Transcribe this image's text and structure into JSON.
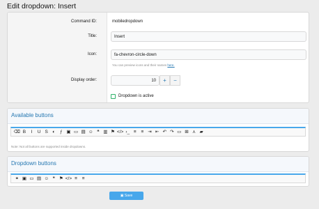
{
  "page": {
    "title": "Edit dropdown: Insert"
  },
  "form": {
    "command_id": {
      "label": "Command ID:",
      "value": "mobiledropdown"
    },
    "title": {
      "label": "Title:",
      "value": "Insert"
    },
    "icon": {
      "label": "Icon:",
      "value": "fa-chevron-circle-down",
      "hint_prefix": "You can preview icons and their names ",
      "hint_link": "here."
    },
    "display_order": {
      "label": "Display order:",
      "value": "10",
      "plus": "+",
      "minus": "−"
    },
    "active": {
      "label": "Dropdown is active",
      "checked": false
    }
  },
  "available": {
    "title": "Available buttons",
    "note": "Note: Not all buttons are supported inside dropdowns.",
    "icons": [
      "eraser-icon",
      "bold-icon",
      "italic-icon",
      "underline-icon",
      "strikethrough-icon",
      "color-drop-icon",
      "font-icon",
      "image-icon",
      "video-icon",
      "media-icon",
      "smiley-icon",
      "quote-icon",
      "spoiler-icon",
      "flag-icon",
      "code-icon",
      "inline-code-icon",
      "unordered-list-icon",
      "ordered-list-icon",
      "indent-icon",
      "outdent-icon",
      "undo-icon",
      "redo-icon",
      "preview-icon",
      "table-icon",
      "align-icon",
      "gallery-icon"
    ],
    "glyphs": [
      "⌫",
      "B",
      "I",
      "U",
      "S",
      "◐",
      "ƒ",
      "▣",
      "▭",
      "▤",
      "☺",
      "❝",
      "▥",
      "⚑",
      "</>",
      "›_",
      "≡",
      "≡",
      "⇥",
      "⇤",
      "↶",
      "↷",
      "▭",
      "⊞",
      "⋏",
      "▰"
    ]
  },
  "dropdown": {
    "title": "Dropdown buttons",
    "icons": [
      "link-icon",
      "image-icon",
      "video-icon",
      "media-icon",
      "smiley-icon",
      "quote-icon",
      "flag-icon",
      "code-icon",
      "unordered-list-icon",
      "ordered-list-icon"
    ],
    "glyphs": [
      "⚭",
      "▣",
      "▭",
      "▤",
      "☺",
      "❝",
      "⚑",
      "</>",
      "≡",
      "≡"
    ]
  },
  "actions": {
    "save_label": "Save"
  }
}
